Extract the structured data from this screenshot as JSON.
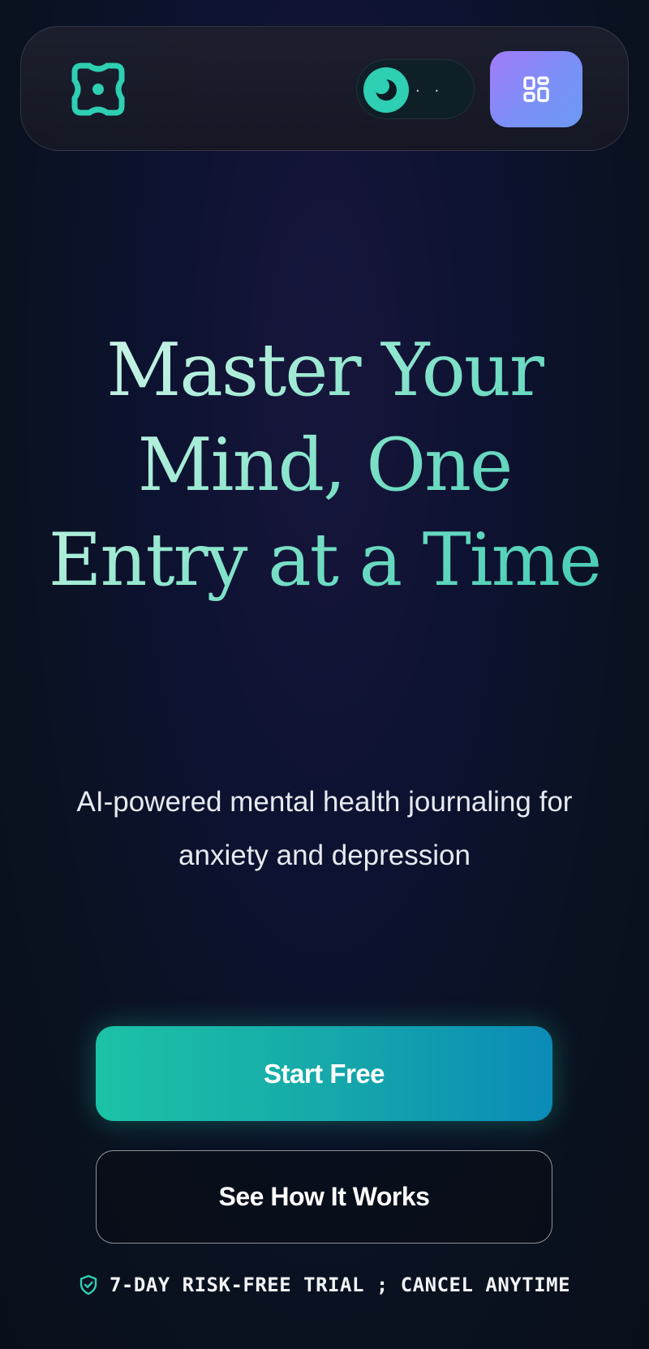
{
  "header": {
    "logo_icon": "focus-scan-logo-icon",
    "theme_toggle": {
      "knob_icon": "moon-icon",
      "dots": "· ·"
    },
    "menu_icon": "grid-menu-icon"
  },
  "hero": {
    "headline_lines": [
      "Master Your",
      "Mind, One",
      "Entry at a Time"
    ],
    "subheadline": "AI-powered mental health journaling for anxiety and depression"
  },
  "actions": {
    "primary_label": "Start Free",
    "secondary_label": "See How It Works"
  },
  "trial": {
    "icon": "shield-check-icon",
    "text": "7-DAY RISK-FREE TRIAL ; CANCEL ANYTIME"
  },
  "colors": {
    "accent_teal": "#2ecfb3",
    "accent_blue": "#0b8bb7",
    "menu_purple": "#a27bfa",
    "background": "#0a1220"
  }
}
